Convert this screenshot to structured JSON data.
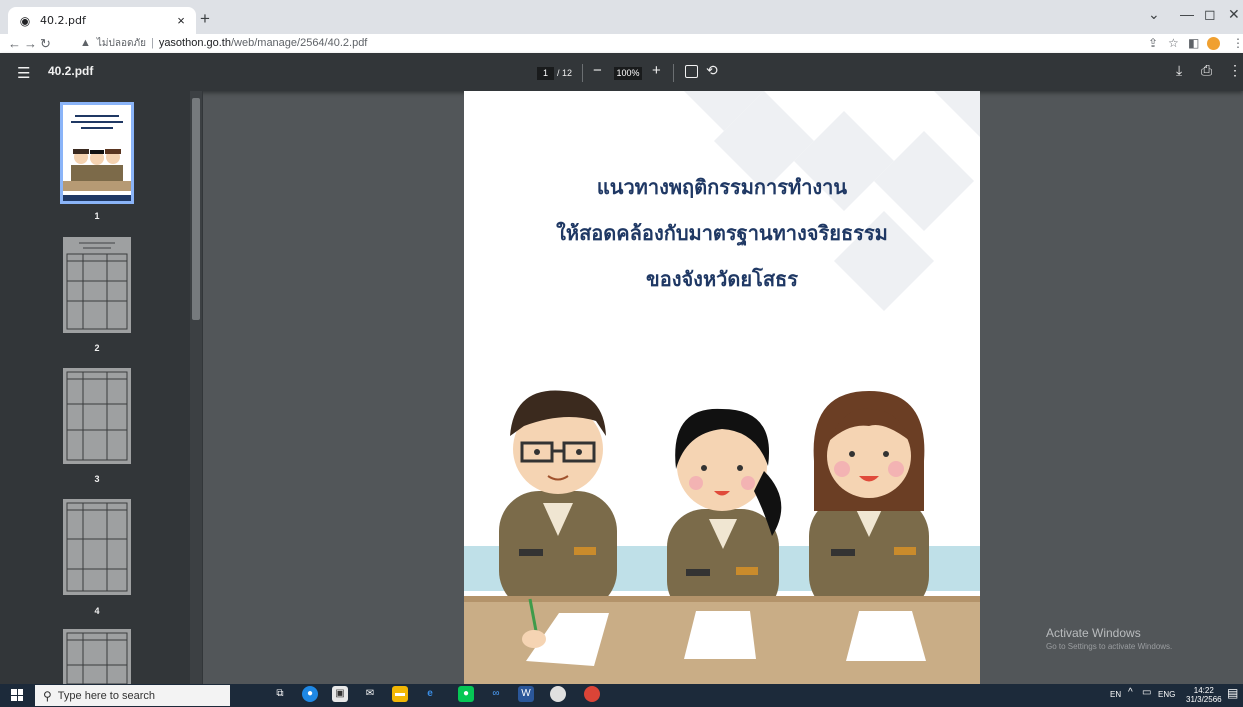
{
  "browser": {
    "tab_title": "40.2.pdf",
    "tab_close": "×",
    "new_tab": "+",
    "security_label": "ไม่ปลอดภัย",
    "url_host": "yasothon.go.th",
    "url_path": "/web/manage/2564/40.2.pdf"
  },
  "pdf_toolbar": {
    "file_name": "40.2.pdf",
    "current_page": "1",
    "total_pages": "/ 12",
    "zoom": "100%"
  },
  "sidebar": {
    "pages": [
      "1",
      "2",
      "3",
      "4"
    ]
  },
  "document": {
    "title_lines": [
      "แนวทางพฤติกรรมการทำงาน",
      "ให้สอดคล้องกับมาตรฐานทางจริยธรรม",
      "ของจังหวัดยโสธร"
    ]
  },
  "watermark": {
    "line1": "Activate Windows",
    "line2": "Go to Settings to activate Windows."
  },
  "taskbar": {
    "search_placeholder": "Type here to search",
    "lang_en": "EN",
    "lang_eng": "ENG",
    "time": "14:22",
    "date": "31/3/2566"
  },
  "colors": {
    "pdf_toolbar": "#323639",
    "viewer_bg": "#525659",
    "title_text": "#1f3864",
    "thumb_selected": "#8ab4f8"
  }
}
